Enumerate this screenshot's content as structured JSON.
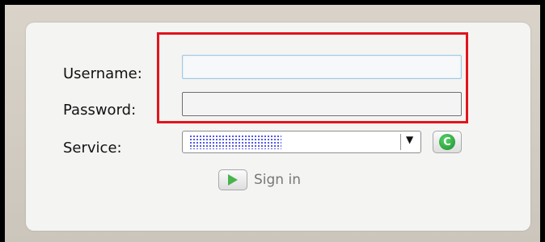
{
  "form": {
    "username_label": "Username:",
    "username_value": "",
    "password_label": "Password:",
    "password_value": "",
    "service_label": "Service:",
    "service_selected": "",
    "signin_label": "Sign in"
  },
  "icons": {
    "dropdown": "chevron-down-icon",
    "refresh": "refresh-icon",
    "signin": "play-icon"
  },
  "colors": {
    "highlight": "#e2141b",
    "refresh": "#1b8f2b",
    "play": "#49b34d"
  }
}
